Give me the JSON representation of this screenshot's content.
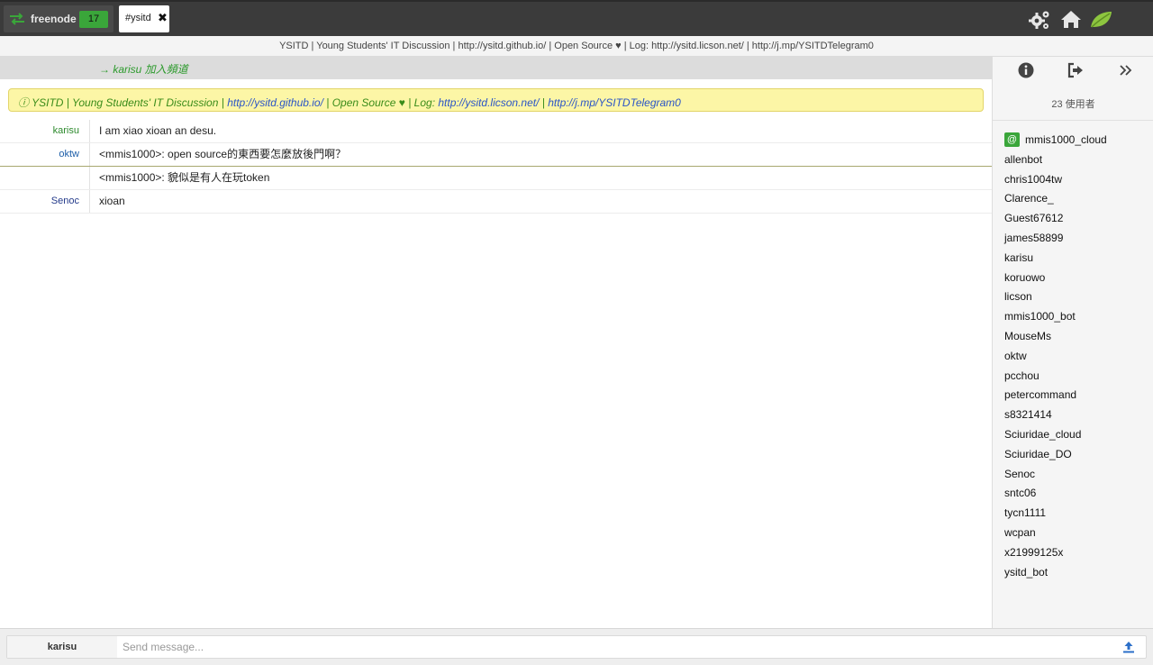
{
  "topbar": {
    "server_name": "freenode",
    "server_badge": "17",
    "channel_name": "#ysitd",
    "close_glyph": "✖",
    "icons": [
      "gears-icon",
      "home-icon",
      "leaf-logo-icon"
    ]
  },
  "topic_line": "YSITD | Young Students' IT Discussion | http://ysitd.github.io/ | Open Source ♥ | Log: http://ysitd.licson.net/ | http://j.mp/YSITDTelegram0",
  "join_notice": "→ karisu 加入頻道",
  "topic_notice": {
    "prefix": "ⓘ YSITD | Young Students' IT Discussion | ",
    "link1": "http://ysitd.github.io/",
    "mid1": " | Open Source ♥ | Log: ",
    "link2": "http://ysitd.licson.net/",
    "mid2": " | ",
    "link3": "http://j.mp/YSITDTelegram0"
  },
  "messages": [
    {
      "nick": "karisu",
      "text": "I am xiao xioan an desu."
    },
    {
      "nick": "oktw",
      "text": "<mmis1000>: open source的東西要怎麼放後門啊？"
    },
    {
      "nick": "",
      "text": "<mmis1000>: 貌似是有人在玩token"
    },
    {
      "nick": "Senoc",
      "text": "xioan"
    }
  ],
  "sidebar": {
    "icons": [
      "info-icon",
      "sign-out-icon",
      "double-chevron-right-icon"
    ],
    "user_count": "23 使用者",
    "op_badge": "@",
    "users": [
      "mmis1000_cloud",
      "allenbot",
      "chris1004tw",
      "Clarence_",
      "Guest67612",
      "james58899",
      "karisu",
      "koruowo",
      "licson",
      "mmis1000_bot",
      "MouseMs",
      "oktw",
      "pcchou",
      "petercommand",
      "s8321414",
      "Sciuridae_cloud",
      "Sciuridae_DO",
      "Senoc",
      "sntc06",
      "tycn1111",
      "wcpan",
      "x21999125x",
      "ysitd_bot"
    ]
  },
  "input": {
    "nick": "karisu",
    "placeholder": "Send message...",
    "value": ""
  },
  "colors": {
    "topbar_bg": "#3b3b3b",
    "badge_green": "#3aa63a",
    "notice_bg": "#fcf6a6",
    "link_blue": "#2b55c6"
  }
}
